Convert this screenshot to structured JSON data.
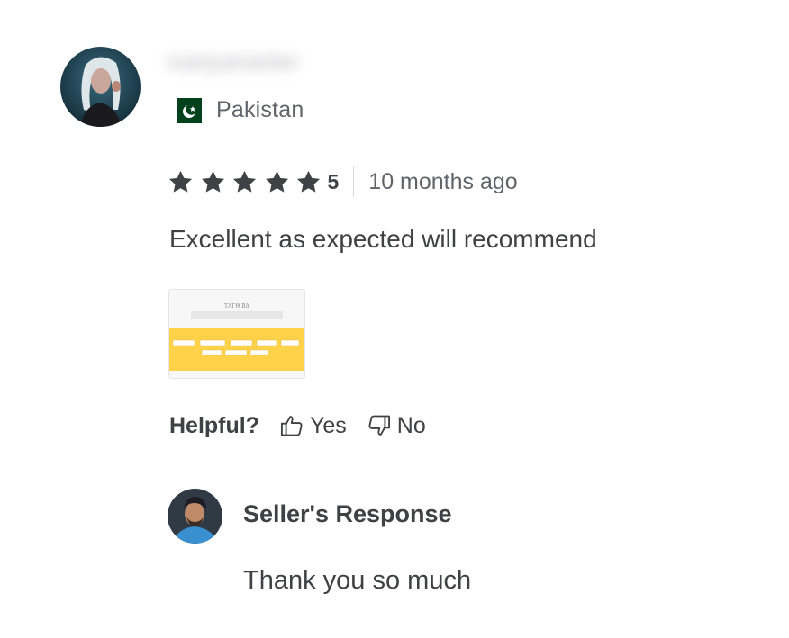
{
  "review": {
    "username": "marlyamariter",
    "country": "Pakistan",
    "rating": 5,
    "rating_label": "5",
    "time_ago": "10 months ago",
    "text": "Excellent as expected will recommend",
    "attachment": {
      "header_text": "ΤΑΓΘ ΒΔ"
    }
  },
  "helpful": {
    "label": "Helpful?",
    "yes_label": "Yes",
    "no_label": "No"
  },
  "seller_response": {
    "title": "Seller's Response",
    "text": "Thank you so much"
  },
  "colors": {
    "text_primary": "#404145",
    "text_secondary": "#62646a",
    "star": "#404145",
    "divider": "#dadbdd",
    "flag_green": "#01411c",
    "attachment_yellow": "#ffd24a"
  },
  "icons": {
    "star": "star-icon",
    "thumbs_up": "thumbs-up-icon",
    "thumbs_down": "thumbs-down-icon",
    "flag": "pakistan-flag-icon"
  }
}
